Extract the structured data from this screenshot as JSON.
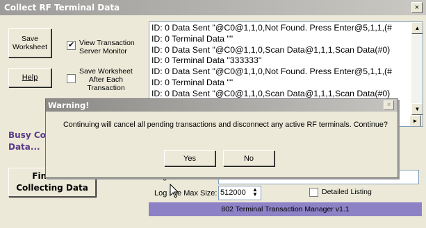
{
  "window": {
    "title": "Collect RF Terminal Data",
    "close_glyph": "×"
  },
  "buttons": {
    "save_worksheet": "Save\nWorksheet",
    "help": "Help",
    "finished": "Finished\nCollecting Data"
  },
  "checkboxes": {
    "view_transaction": {
      "label": "View Transaction\nServer Monitor",
      "checked": true
    },
    "save_after": {
      "label": "Save Worksheet\nAfter Each\nTransaction",
      "checked": false
    }
  },
  "log_lines": [
    "ID: 0 Data Sent \"@C0@1,1,0,Not Found. Press Enter@5,1,1,(#",
    "ID: 0 Terminal Data \"\"",
    "ID: 0 Data Sent \"@C0@1,1,0,Scan Data@1,1,1,Scan Data(#0)",
    "ID: 0 Terminal Data \"333333\"",
    "ID: 0 Data Sent \"@C0@1,1,0,Not Found. Press Enter@5,1,1,(#",
    "ID: 0 Terminal Data \"\"",
    "ID: 0 Data Sent \"@C0@1,1,0,Scan Data@1,1,1,Scan Data(#0)"
  ],
  "busy_text": "Busy Collecting\nData...",
  "log_file": {
    "name_label": "Log File Name:",
    "name_value": "",
    "max_size_label": "Log File Max Size:",
    "max_size_value": "512000"
  },
  "detailed_listing": {
    "label": "Detailed Listing",
    "checked": false
  },
  "status": "802 Terminal Transaction Manager v1.1",
  "dialog": {
    "title": "Warning!",
    "message": "Continuing will cancel all pending transactions and disconnect any active RF terminals. Continue?",
    "yes": "Yes",
    "no": "No",
    "close_glyph": "×"
  }
}
